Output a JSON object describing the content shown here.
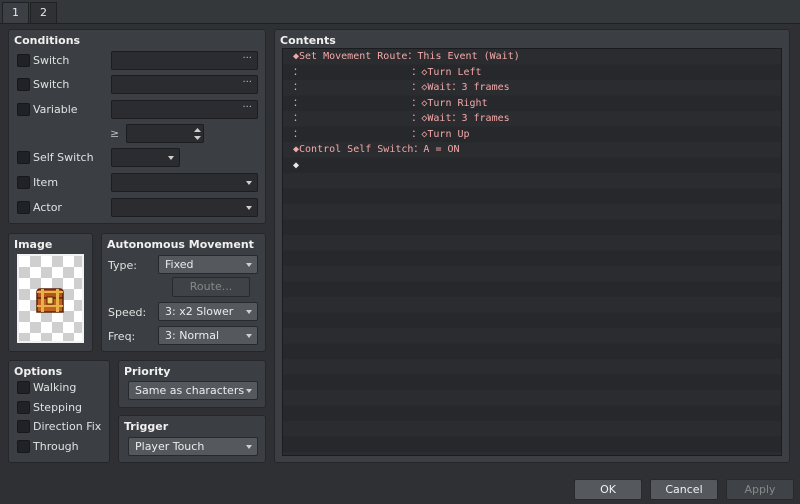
{
  "tabs": [
    "1",
    "2"
  ],
  "conditions": {
    "title": "Conditions",
    "switch1_label": "Switch",
    "switch2_label": "Switch",
    "variable_label": "Variable",
    "gte_symbol": "≥",
    "self_switch_label": "Self Switch",
    "item_label": "Item",
    "actor_label": "Actor",
    "ellipsis": "···"
  },
  "image": {
    "title": "Image",
    "sprite_icon": "treasure-chest-icon"
  },
  "autonomous": {
    "title": "Autonomous Movement",
    "type_label": "Type:",
    "type_value": "Fixed",
    "route_button": "Route...",
    "speed_label": "Speed:",
    "speed_value": "3: x2 Slower",
    "freq_label": "Freq:",
    "freq_value": "3: Normal"
  },
  "options": {
    "title": "Options",
    "items": [
      "Walking",
      "Stepping",
      "Direction Fix",
      "Through"
    ]
  },
  "priority": {
    "title": "Priority",
    "value": "Same as characters"
  },
  "trigger": {
    "title": "Trigger",
    "value": "Player Touch"
  },
  "contents": {
    "title": "Contents",
    "lines": [
      "◆Set Movement Route：This Event (Wait)",
      "：                  ：◇Turn Left",
      "：                  ：◇Wait：3 frames",
      "：                  ：◇Turn Right",
      "：                  ：◇Wait：3 frames",
      "：                  ：◇Turn Up",
      "◆Control Self Switch：A = ON",
      "◆"
    ]
  },
  "footer": {
    "ok": "OK",
    "cancel": "Cancel",
    "apply": "Apply"
  },
  "colors": {
    "command_text": "#f4a9a9",
    "panel_bg": "#3b3e42",
    "window_bg": "#2e3033"
  }
}
